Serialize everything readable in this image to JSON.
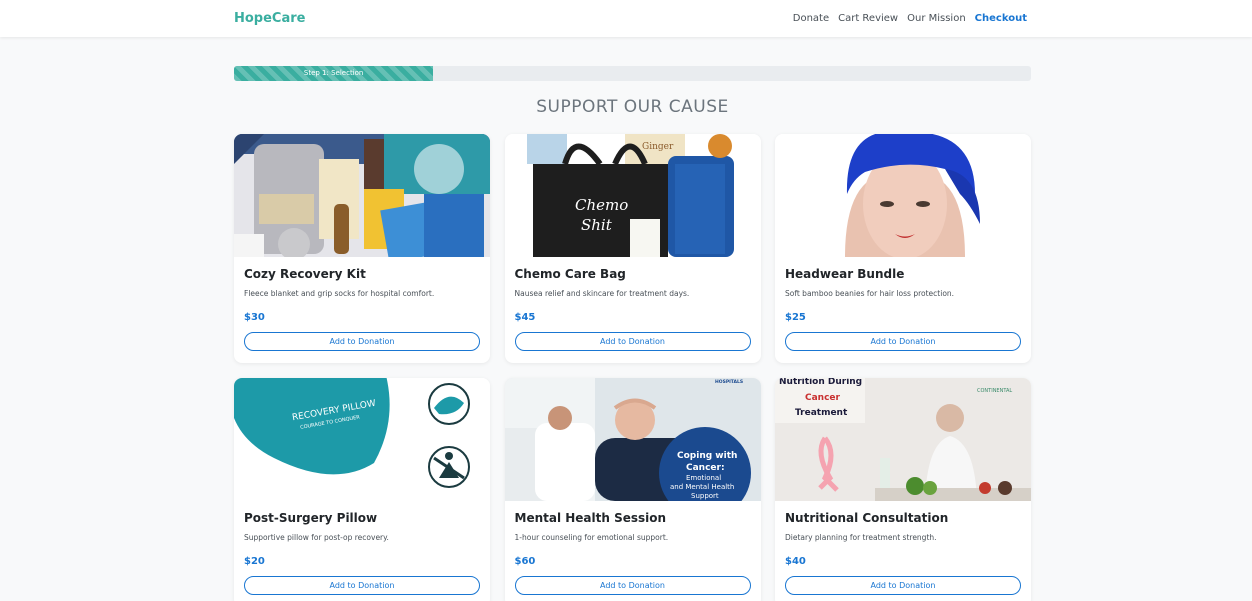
{
  "brand": "HopeCare",
  "nav": [
    {
      "label": "Donate"
    },
    {
      "label": "Cart Review"
    },
    {
      "label": "Our Mission"
    },
    {
      "label": "Checkout"
    }
  ],
  "progress": {
    "label": "Step 1: Selection",
    "percent": 25
  },
  "section_title": "SUPPORT OUR CAUSE",
  "products": [
    {
      "title": "Cozy Recovery Kit",
      "description": "Fleece blanket and grip socks for hospital comfort.",
      "price": "$30",
      "button": "Add to Donation"
    },
    {
      "title": "Chemo Care Bag",
      "description": "Nausea relief and skincare for treatment days.",
      "price": "$45",
      "button": "Add to Donation",
      "image_text": [
        "Chemo",
        "Shit",
        "Ginger"
      ]
    },
    {
      "title": "Headwear Bundle",
      "description": "Soft bamboo beanies for hair loss protection.",
      "price": "$25",
      "button": "Add to Donation"
    },
    {
      "title": "Post-Surgery Pillow",
      "description": "Supportive pillow for post-op recovery.",
      "price": "$20",
      "button": "Add to Donation",
      "image_text": [
        "RECOVERY PILLOW",
        "COURAGE TO CONQUER"
      ]
    },
    {
      "title": "Mental Health Session",
      "description": "1-hour counseling for emotional support.",
      "price": "$60",
      "button": "Add to Donation",
      "image_text": [
        "Coping with",
        "Cancer:",
        "Emotional",
        "and Mental Health",
        "Support",
        "HOSPITALS"
      ]
    },
    {
      "title": "Nutritional Consultation",
      "description": "Dietary planning for treatment strength.",
      "price": "$40",
      "button": "Add to Donation",
      "image_text": [
        "Nutrition During",
        "Cancer",
        "Treatment",
        "CONTINENTAL"
      ]
    }
  ],
  "colors": {
    "brand": "#3aaea0",
    "accent": "#1976d2",
    "text_muted": "#6c757d"
  }
}
